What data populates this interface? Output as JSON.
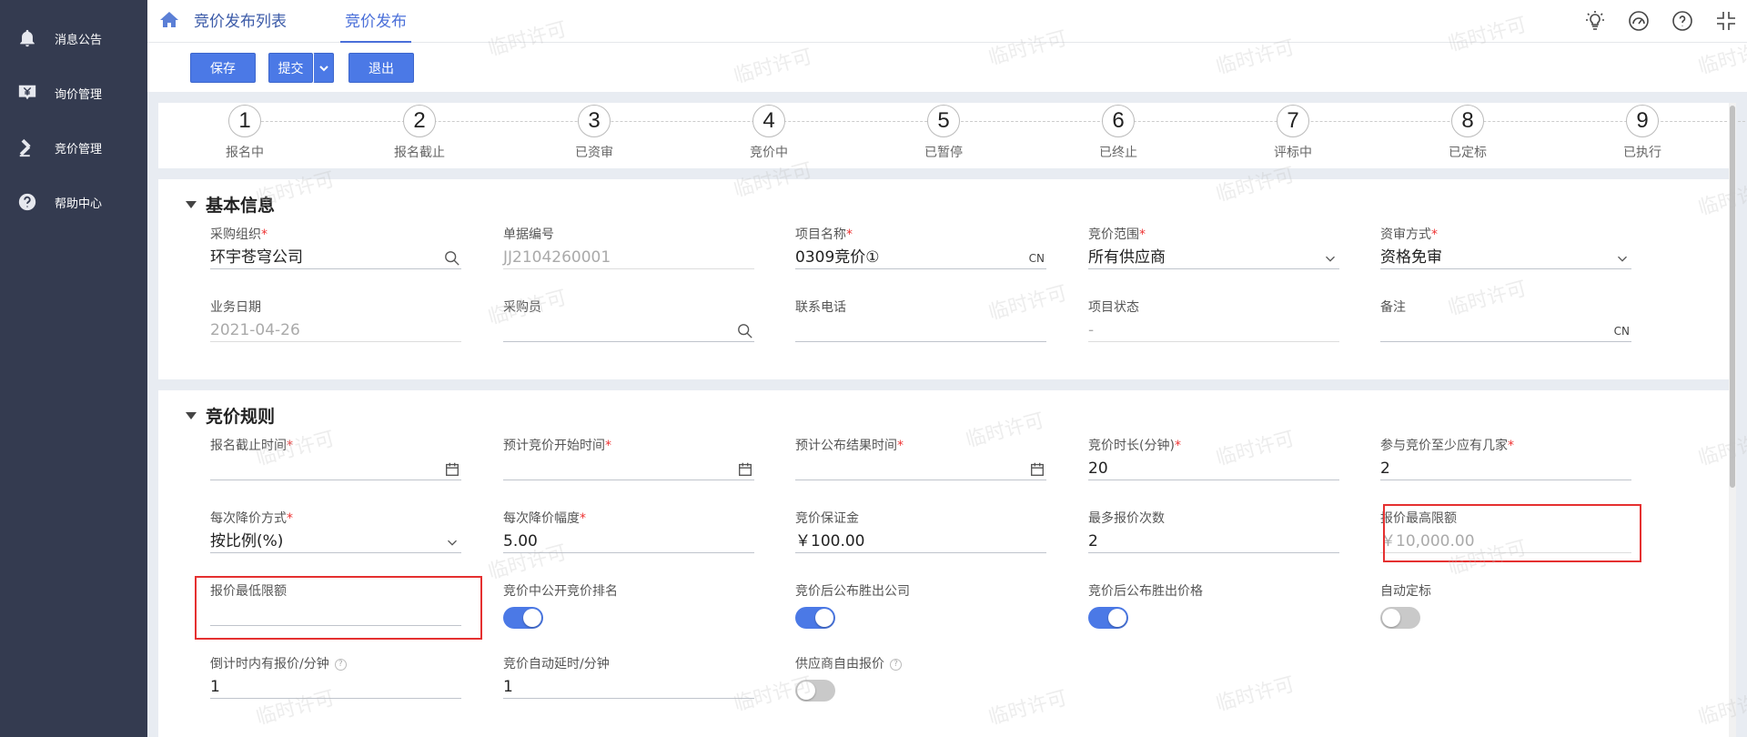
{
  "sidebar": {
    "items": [
      {
        "label": "消息公告",
        "icon": "bell-icon"
      },
      {
        "label": "询价管理",
        "icon": "yen-icon"
      },
      {
        "label": "竞价管理",
        "icon": "gavel-icon"
      },
      {
        "label": "帮助中心",
        "icon": "help-icon"
      }
    ]
  },
  "header": {
    "tabs": [
      {
        "label": "竞价发布列表",
        "active": false
      },
      {
        "label": "竞价发布",
        "active": true
      }
    ],
    "icons": [
      "lightbulb-icon",
      "dashboard-icon",
      "question-icon",
      "fullscreen-exit-icon"
    ]
  },
  "toolbar": {
    "save_label": "保存",
    "submit_label": "提交",
    "exit_label": "退出"
  },
  "steps": [
    {
      "num": "1",
      "label": "报名中"
    },
    {
      "num": "2",
      "label": "报名截止"
    },
    {
      "num": "3",
      "label": "已资审"
    },
    {
      "num": "4",
      "label": "竞价中"
    },
    {
      "num": "5",
      "label": "已暂停"
    },
    {
      "num": "6",
      "label": "已终止"
    },
    {
      "num": "7",
      "label": "评标中"
    },
    {
      "num": "8",
      "label": "已定标"
    },
    {
      "num": "9",
      "label": "已执行"
    }
  ],
  "basic": {
    "title": "基本信息",
    "org": {
      "label": "采购组织",
      "value": "环宇苍穹公司"
    },
    "doc_no": {
      "label": "单据编号",
      "value": "JJ2104260001"
    },
    "project_name": {
      "label": "项目名称",
      "value": "0309竞价①",
      "lang": "CN"
    },
    "scope": {
      "label": "竞价范围",
      "value": "所有供应商"
    },
    "review": {
      "label": "资审方式",
      "value": "资格免审"
    },
    "biz_date": {
      "label": "业务日期",
      "value": "2021-04-26"
    },
    "buyer": {
      "label": "采购员",
      "value": ""
    },
    "phone": {
      "label": "联系电话",
      "value": ""
    },
    "status": {
      "label": "项目状态",
      "value": "-"
    },
    "remark": {
      "label": "备注",
      "value": "",
      "lang": "CN"
    }
  },
  "rules": {
    "title": "竞价规则",
    "signup_deadline": {
      "label": "报名截止时间",
      "value": ""
    },
    "start_time": {
      "label": "预计竞价开始时间",
      "value": ""
    },
    "publish_time": {
      "label": "预计公布结果时间",
      "value": ""
    },
    "duration": {
      "label": "竞价时长(分钟)",
      "value": "20"
    },
    "min_suppliers": {
      "label": "参与竞价至少应有几家",
      "value": "2"
    },
    "decrease_mode": {
      "label": "每次降价方式",
      "value": "按比例(%)"
    },
    "decrease_amount": {
      "label": "每次降价幅度",
      "value": "5.00"
    },
    "deposit": {
      "label": "竞价保证金",
      "value": "￥100.00"
    },
    "max_bids": {
      "label": "最多报价次数",
      "value": "2"
    },
    "max_limit": {
      "label": "报价最高限额",
      "value": "￥10,000.00"
    },
    "min_limit": {
      "label": "报价最低限额",
      "value": ""
    },
    "show_rank": {
      "label": "竞价中公开竞价排名",
      "on": true
    },
    "show_winner": {
      "label": "竞价后公布胜出公司",
      "on": true
    },
    "show_price": {
      "label": "竞价后公布胜出价格",
      "on": true
    },
    "auto_award": {
      "label": "自动定标",
      "on": false
    },
    "countdown": {
      "label": "倒计时内有报价/分钟",
      "value": "1"
    },
    "auto_extend": {
      "label": "竞价自动延时/分钟",
      "value": "1"
    },
    "free_bid": {
      "label": "供应商自由报价",
      "on": false
    }
  },
  "watermark_text": "临时许可",
  "colors": {
    "accent": "#4b79e6",
    "sidebar": "#343b50",
    "highlight": "#e53030"
  }
}
